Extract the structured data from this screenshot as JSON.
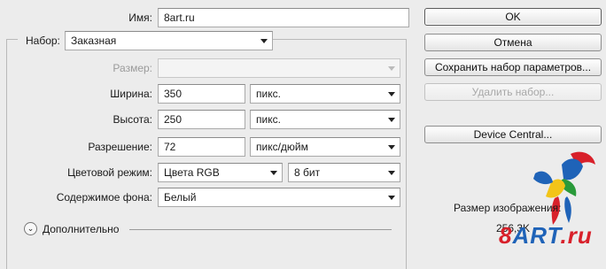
{
  "name_row": {
    "label": "Имя:",
    "value": "8art.ru"
  },
  "preset_row": {
    "label": "Набор:",
    "value": "Заказная"
  },
  "size_row": {
    "label": "Размер:",
    "value": ""
  },
  "width_row": {
    "label": "Ширина:",
    "value": "350",
    "unit": "пикс."
  },
  "height_row": {
    "label": "Высота:",
    "value": "250",
    "unit": "пикс."
  },
  "resolution_row": {
    "label": "Разрешение:",
    "value": "72",
    "unit": "пикс/дюйм"
  },
  "color_mode_row": {
    "label": "Цветовой режим:",
    "value": "Цвета RGB",
    "depth": "8 бит"
  },
  "background_row": {
    "label": "Содержимое фона:",
    "value": "Белый"
  },
  "advanced": {
    "label": "Дополнительно"
  },
  "buttons": {
    "ok": "OK",
    "cancel": "Отмена",
    "save_preset": "Сохранить набор параметров...",
    "delete_preset": "Удалить набор...",
    "device_central": "Device Central..."
  },
  "image_size": {
    "label": "Размер изображения:",
    "value": "256,3K"
  },
  "watermark": {
    "text_8": "8",
    "text_art": "ART",
    "text_ru": ".ru"
  },
  "colors": {
    "logo_blue": "#1f63b8",
    "logo_red": "#d8202a",
    "dialog_bg": "#ececec"
  }
}
